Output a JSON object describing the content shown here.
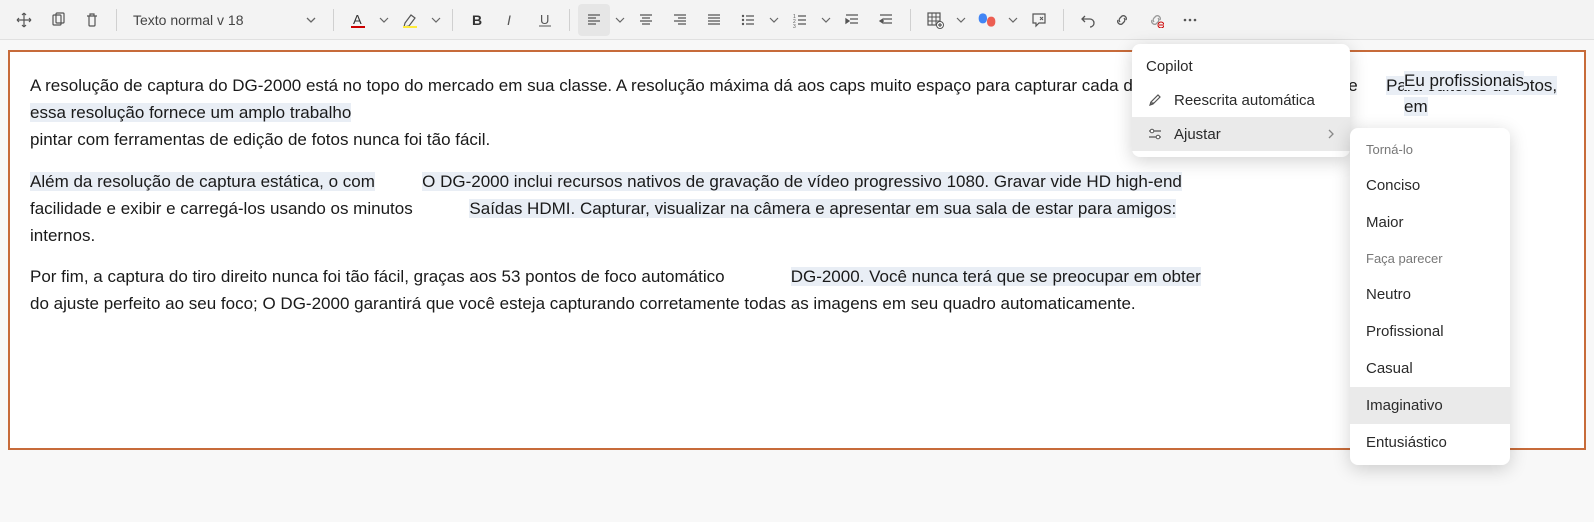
{
  "toolbar": {
    "style_label": "Texto normal v 18"
  },
  "doc": {
    "p1_a": "A resolução de captura do DG-2000 está no topo do mercado em sua classe. A resolução máxima dá aos caps muito espaço para capturar cada detalhe em um único quadro. e",
    "p1_b": "Para editores de fotos, essa resolução fornece um amplo trabalho",
    "p1_c": "pintar com ferramentas de edição de fotos nunca foi tão fácil.",
    "side_a": "Eu profissionais",
    "side_b": "em",
    "p2_a": "Além da resolução de captura estática, o com",
    "p2_b": "O DG-2000 inclui recursos nativos de gravação de vídeo progressivo 1080. Gravar vide HD high-end",
    "p2_c": "facilidade e exibir e carregá-los usando os minutos",
    "p2_d": "Saídas HDMI. Capturar, visualizar na câmera e apresentar em sua sala de estar para amigos:",
    "p2_e": "internos.",
    "p3_a": "Por fim, a captura do tiro direito nunca foi tão fácil, graças aos 53 pontos de foco automático",
    "p3_b": "DG-2000. Você nunca terá que se preocupar em obter",
    "p3_c": "do ajuste perfeito ao seu foco; O DG-2000 garantirá que você esteja capturando corretamente todas as imagens em seu quadro automaticamente."
  },
  "copilot_menu": {
    "title": "Copilot",
    "rewrite": "Reescrita automática",
    "adjust": "Ajustar"
  },
  "submenu": {
    "head1": "Torná-lo",
    "concise": "Conciso",
    "longer": "Maior",
    "head2": "Faça parecer",
    "neutral": "Neutro",
    "professional": "Profissional",
    "casual": "Casual",
    "imaginative": "Imaginativo",
    "enthusiastic": "Entusiástico"
  }
}
